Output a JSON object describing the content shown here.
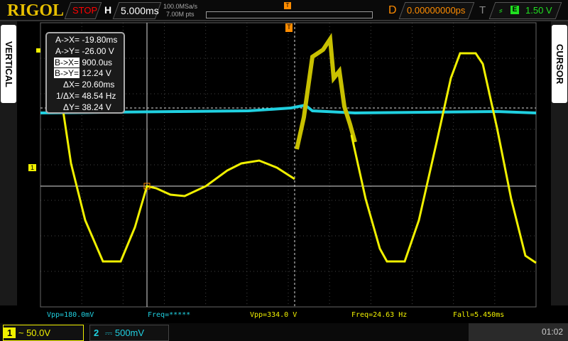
{
  "header": {
    "logo": "RIGOL",
    "run_state": "STOP",
    "h_label": "H",
    "timebase": "5.000ms",
    "sample_rate": "100.0MSa/s",
    "mem_depth": "7.00M pts",
    "d_label": "D",
    "delay": "0.00000000ps",
    "t_label": "T",
    "trigger_source": "E",
    "trigger_level": "1.50 V"
  },
  "side": {
    "left_label": "VERTICAL",
    "right_label": "CURSOR"
  },
  "cursor": {
    "rows": [
      {
        "label": "A->X=",
        "value": "-19.80ms"
      },
      {
        "label": "A->Y=",
        "value": "-26.00 V"
      },
      {
        "label": "B->X=",
        "value": "900.0us"
      },
      {
        "label": "B->Y=",
        "value": "12.24 V"
      },
      {
        "label": "ΔX=",
        "value": "20.60ms"
      },
      {
        "label": "1/ΔX=",
        "value": "48.54 Hz"
      },
      {
        "label": "ΔY=",
        "value": "38.24 V"
      }
    ]
  },
  "measurements": [
    "Vpp=180.0mV",
    "Freq=*****",
    "Vpp=334.0 V",
    "Freq=24.63 Hz",
    "Fall=5.450ms"
  ],
  "channels": [
    {
      "num": "1",
      "coupling": "~",
      "scale": "50.0V",
      "color": "#ffff00"
    },
    {
      "num": "2",
      "coupling": "⎓",
      "scale": "500mV",
      "color": "#00e0ff"
    }
  ],
  "markers": {
    "ch1": "1",
    "trigger": "T"
  },
  "time": "01:02",
  "colors": {
    "ch1": "#f0f000",
    "ch2": "#20d0e0",
    "orange": "#ff8c00",
    "green": "#20e020"
  }
}
